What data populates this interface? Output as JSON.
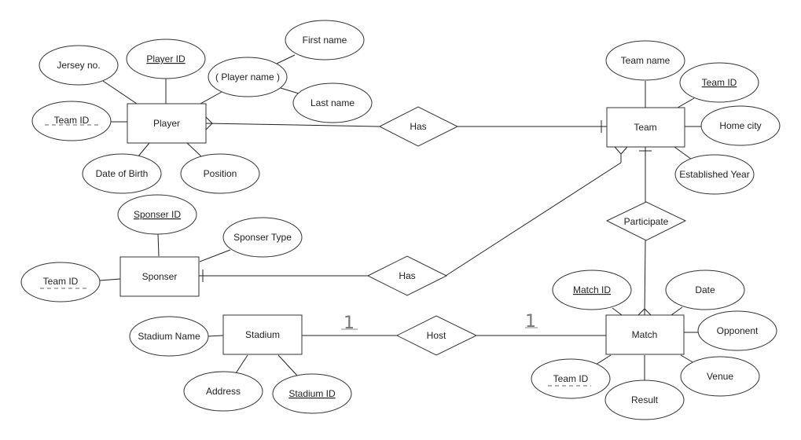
{
  "entities": {
    "player": "Player",
    "team": "Team",
    "sponser": "Sponser",
    "stadium": "Stadium",
    "match": "Match"
  },
  "relationships": {
    "player_team": "Has",
    "sponser_team": "Has",
    "team_match": "Participate",
    "stadium_match": "Host"
  },
  "attributes": {
    "player": {
      "jersey_no": "Jersey no.",
      "player_id": "Player ID",
      "player_name": "( Player name )",
      "first_name": "First name",
      "last_name": "Last name",
      "team_id": "Team ID",
      "date_of_birth": "Date of Birth",
      "position": "Position"
    },
    "team": {
      "team_name": "Team name",
      "team_id": "Team ID",
      "home_city": "Home city",
      "established_year": "Established Year"
    },
    "sponser": {
      "sponser_id": "Sponser ID",
      "sponser_type": "Sponser Type",
      "team_id": "Team ID"
    },
    "stadium": {
      "stadium_name": "Stadium Name",
      "address": "Address",
      "stadium_id": "Stadium ID"
    },
    "match": {
      "match_id": "Match ID",
      "date": "Date",
      "opponent": "Opponent",
      "team_id": "Team ID",
      "result": "Result",
      "venue": "Venue"
    }
  },
  "cardinality_labels": {
    "stadium_side": "1",
    "match_side": "1"
  }
}
